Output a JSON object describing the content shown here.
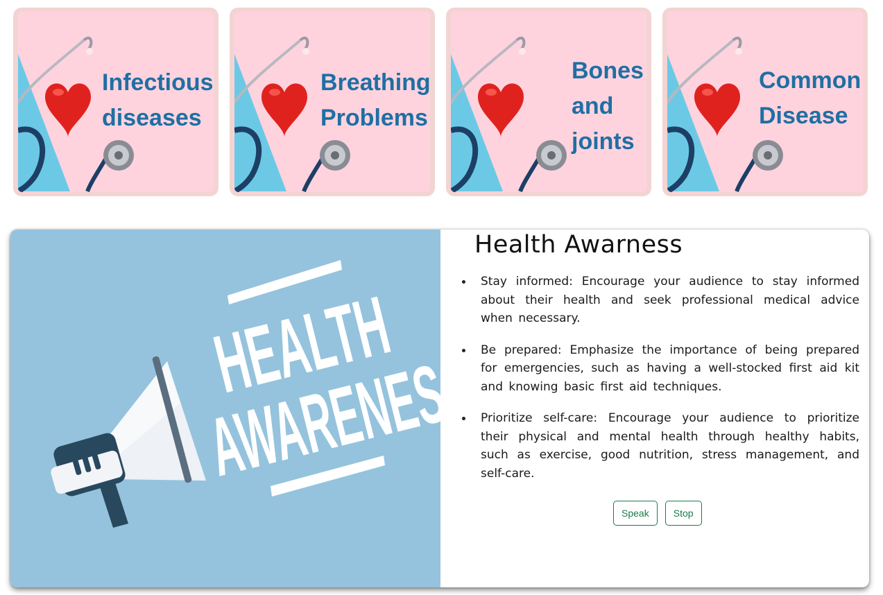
{
  "categories": [
    {
      "line1": "Infectious",
      "line2": "diseases",
      "line3": ""
    },
    {
      "line1": "Breathing",
      "line2": "Problems",
      "line3": ""
    },
    {
      "line1": "Bones",
      "line2": "and",
      "line3": "joints"
    },
    {
      "line1": "Common",
      "line2": "Disease",
      "line3": ""
    }
  ],
  "awareness": {
    "image_text": [
      "HEALTH",
      "AWARENESS"
    ],
    "title": "Health Awarness",
    "tips": [
      "Stay informed: Encourage your audience to stay informed about their health and seek professional medical advice when necessary.",
      "Be prepared: Emphasize the importance of being prepared for emergencies, such as having a well-stocked first aid kit and knowing basic first aid techniques.",
      "Prioritize self-care: Encourage your audience to prioritize their physical and mental health through healthy habits, such as exercise, good nutrition, stress management, and self-care."
    ],
    "speak_label": "Speak",
    "stop_label": "Stop"
  },
  "colors": {
    "card_frame": "#f3d4d2",
    "card_pink": "#ffd3de",
    "card_blue": "#6cc9e6",
    "label_blue": "#1f6fa3",
    "hero_blue": "#95c3dd",
    "button_green": "#1a7a4c"
  }
}
